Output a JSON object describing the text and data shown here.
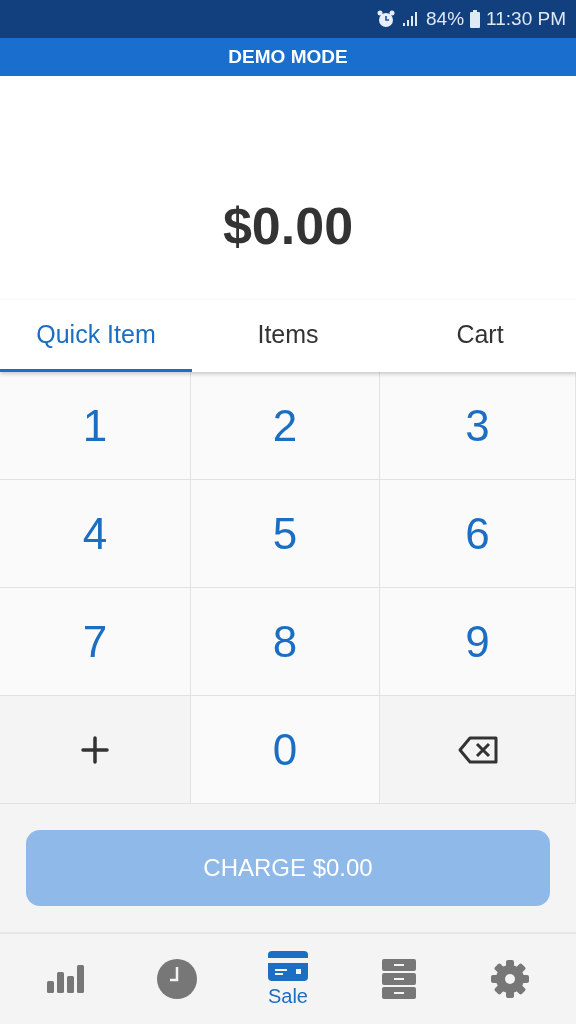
{
  "status_bar": {
    "battery": "84%",
    "time": "11:30 PM"
  },
  "banner": "DEMO MODE",
  "amount": "$0.00",
  "tabs": [
    {
      "label": "Quick Item",
      "selected": true
    },
    {
      "label": "Items",
      "selected": false
    },
    {
      "label": "Cart",
      "selected": false
    }
  ],
  "keypad": [
    {
      "kind": "digit",
      "label": "1"
    },
    {
      "kind": "digit",
      "label": "2"
    },
    {
      "kind": "digit",
      "label": "3"
    },
    {
      "kind": "digit",
      "label": "4"
    },
    {
      "kind": "digit",
      "label": "5"
    },
    {
      "kind": "digit",
      "label": "6"
    },
    {
      "kind": "digit",
      "label": "7"
    },
    {
      "kind": "digit",
      "label": "8"
    },
    {
      "kind": "digit",
      "label": "9"
    },
    {
      "kind": "plus"
    },
    {
      "kind": "digit",
      "label": "0"
    },
    {
      "kind": "backspace"
    }
  ],
  "charge_button": {
    "label": "CHARGE $0.00",
    "disabled": true
  },
  "bottom_nav": [
    {
      "kind": "reports",
      "selected": false
    },
    {
      "kind": "history",
      "selected": false
    },
    {
      "kind": "sale",
      "label": "Sale",
      "selected": true
    },
    {
      "kind": "inventory",
      "selected": false
    },
    {
      "kind": "settings",
      "selected": false
    }
  ]
}
